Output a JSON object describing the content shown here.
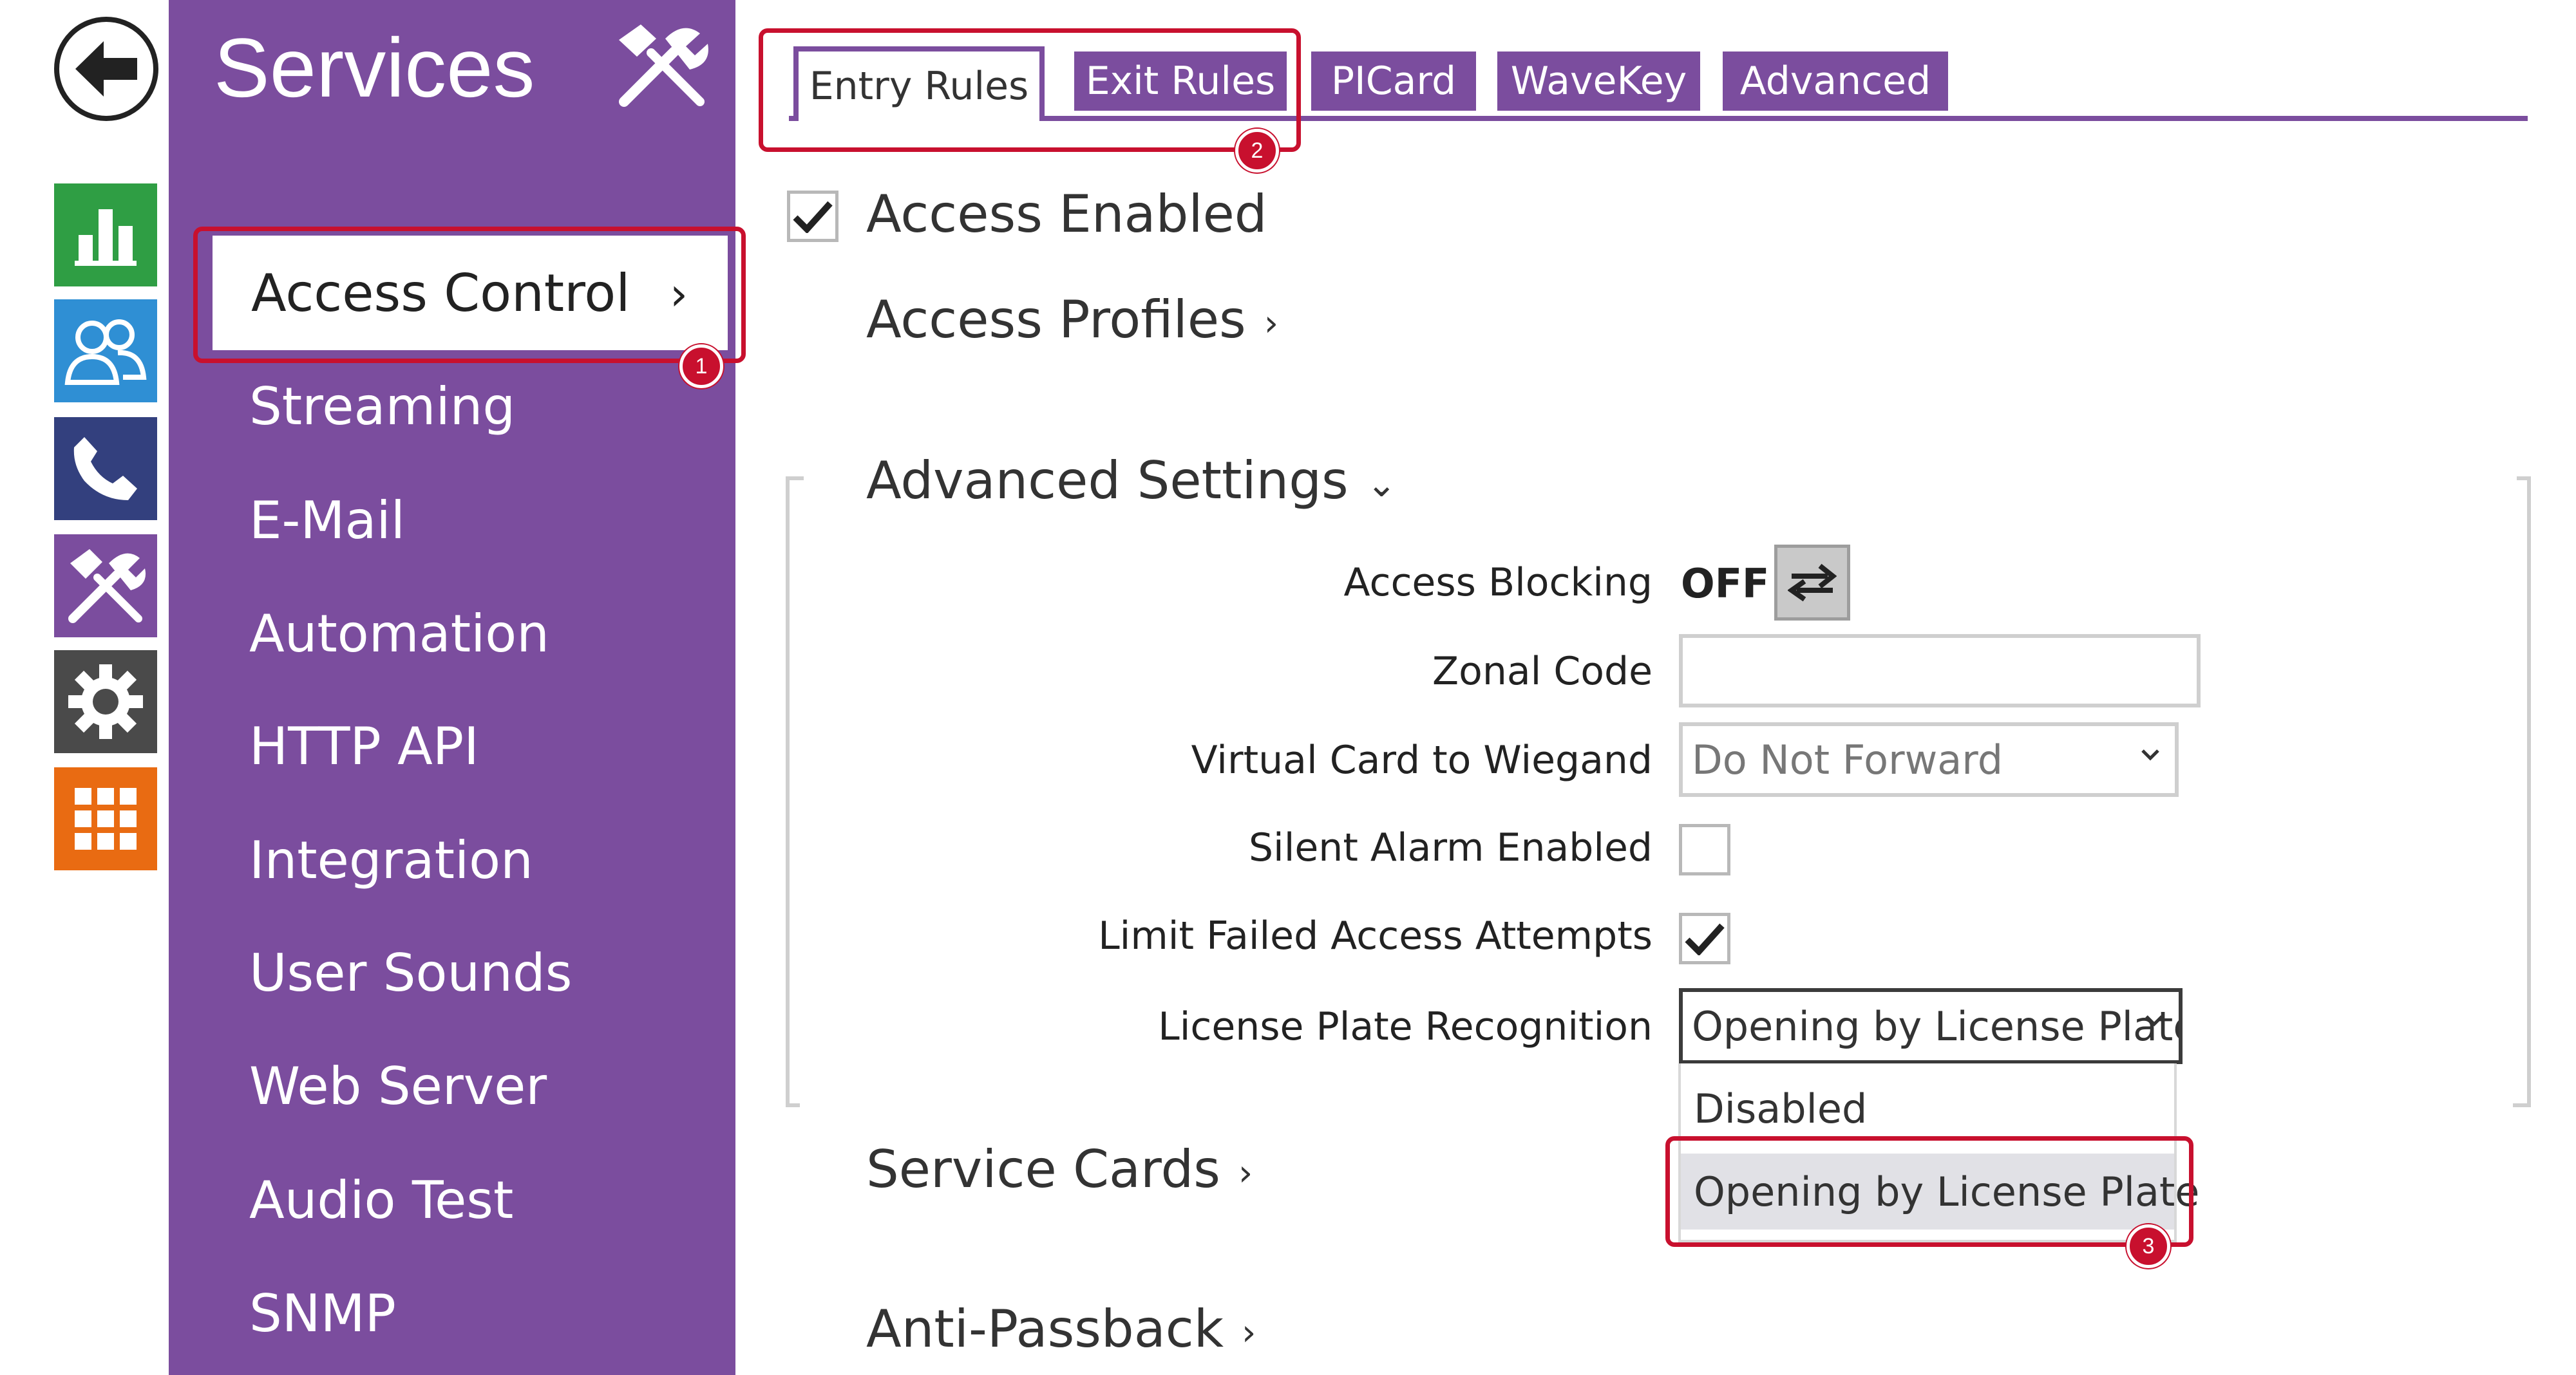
{
  "nav": {
    "back_icon": "arrow-left-icon",
    "rail": [
      {
        "name": "status",
        "icon": "bar-chart-icon",
        "color": "#2f9e44"
      },
      {
        "name": "directory",
        "icon": "users-icon",
        "color": "#2f8fd4"
      },
      {
        "name": "phone",
        "icon": "phone-icon",
        "color": "#33407e"
      },
      {
        "name": "services",
        "icon": "tools-icon",
        "color": "#7b4d9e"
      },
      {
        "name": "system",
        "icon": "gear-icon",
        "color": "#4a4a4a"
      },
      {
        "name": "apps",
        "icon": "grid-icon",
        "color": "#e96b12"
      }
    ]
  },
  "sidebar": {
    "title": "Services",
    "items": [
      {
        "label": "Access Control",
        "active": true
      },
      {
        "label": "Streaming"
      },
      {
        "label": "E-Mail"
      },
      {
        "label": "Automation"
      },
      {
        "label": "HTTP API"
      },
      {
        "label": "Integration"
      },
      {
        "label": "User Sounds"
      },
      {
        "label": "Web Server"
      },
      {
        "label": "Audio Test"
      },
      {
        "label": "SNMP"
      }
    ],
    "color": "#7b4d9e"
  },
  "tabs": [
    {
      "label": "Entry Rules",
      "active": true
    },
    {
      "label": "Exit Rules"
    },
    {
      "label": "PICard"
    },
    {
      "label": "WaveKey"
    },
    {
      "label": "Advanced"
    }
  ],
  "main": {
    "access_enabled": {
      "label": "Access Enabled",
      "checked": true
    },
    "access_profiles": "Access Profiles",
    "advanced_settings": {
      "title": "Advanced Settings",
      "access_blocking": {
        "label": "Access Blocking",
        "state": "OFF"
      },
      "zonal_code": {
        "label": "Zonal Code",
        "value": ""
      },
      "virtual_card": {
        "label": "Virtual Card to Wiegand",
        "value": "Do Not Forward"
      },
      "silent_alarm": {
        "label": "Silent Alarm Enabled",
        "checked": false
      },
      "limit_failed": {
        "label": "Limit Failed Access Attempts",
        "checked": true
      },
      "lpr": {
        "label": "License Plate Recognition",
        "value": "Opening by License Plate",
        "options": [
          "Disabled",
          "Opening by License Plate"
        ]
      }
    },
    "service_cards": "Service Cards",
    "anti_passback": "Anti-Passback"
  },
  "callouts": [
    "1",
    "2",
    "3"
  ],
  "accent": "#c8102e"
}
